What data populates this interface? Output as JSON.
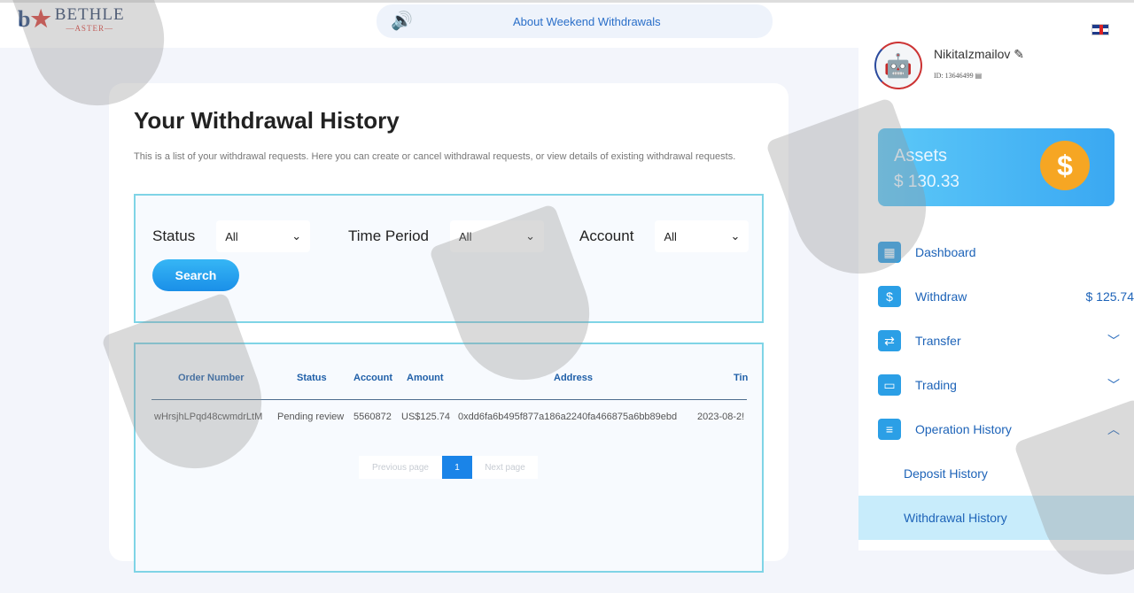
{
  "brand": {
    "name": "BETHLE",
    "sub": "—ASTER—"
  },
  "notice": {
    "text": "About Weekend Withdrawals"
  },
  "page": {
    "title": "Your Withdrawal History",
    "description": "This is a list of your withdrawal requests. Here you can create or cancel withdrawal requests, or view details of existing withdrawal requests."
  },
  "filters": {
    "status_label": "Status",
    "status_value": "All",
    "period_label": "Time Period",
    "period_value": "All",
    "account_label": "Account",
    "account_value": "All",
    "search_label": "Search"
  },
  "table": {
    "headers": [
      "Order Number",
      "Status",
      "Account",
      "Amount",
      "Address",
      "Tin"
    ],
    "rows": [
      [
        "wHrsjhLPqd48cwmdrLtM",
        "Pending review",
        "5560872",
        "US$125.74",
        "0xdd6fa6b495f877a186a2240fa466875a6bb89ebd",
        "2023-08-2!"
      ]
    ]
  },
  "pager": {
    "prev": "Previous page",
    "current": "1",
    "next": "Next page"
  },
  "user": {
    "name": "NikitaIzmailov",
    "id": "ID:  13646499"
  },
  "assets": {
    "label": "Assets",
    "value": "$ 130.33"
  },
  "nav": [
    {
      "label": "Dashboard",
      "icon": "▦"
    },
    {
      "label": "Withdraw",
      "icon": "$",
      "value": "$ 125.74"
    },
    {
      "label": "Transfer",
      "icon": "⇄",
      "chev": "﹀"
    },
    {
      "label": "Trading",
      "icon": "▭",
      "chev": "﹀"
    },
    {
      "label": "Operation History",
      "icon": "≡",
      "chev": "︿"
    },
    {
      "label": "Deposit History"
    },
    {
      "label": "Withdrawal History"
    }
  ]
}
